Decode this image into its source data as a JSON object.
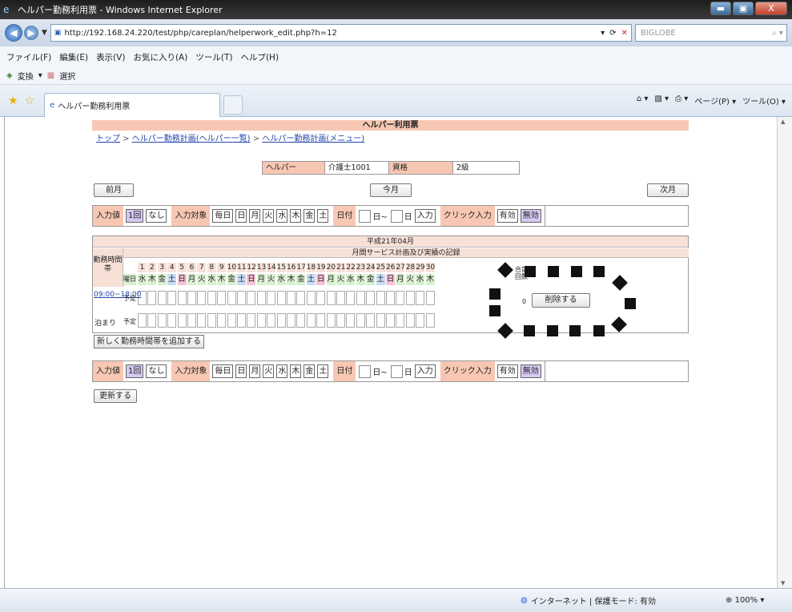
{
  "window": {
    "title": "ヘルパー勤務利用票 - Windows Internet Explorer",
    "btn_min": "▬",
    "btn_max": "▣",
    "btn_close": "X"
  },
  "browser": {
    "url": "http://192.168.24.220/test/php/careplan/helperwork_edit.php?h=12",
    "search_placeholder": "BIGLOBE",
    "menu": [
      "ファイル(F)",
      "編集(E)",
      "表示(V)",
      "お気に入り(A)",
      "ツール(T)",
      "ヘルプ(H)"
    ],
    "fav": [
      "変換",
      "選択"
    ],
    "tab_title": "ヘルパー勤務利用票",
    "tools": [
      "ページ(P) ▾",
      "ツール(O) ▾"
    ],
    "status_zone": "インターネット | 保護モード: 有効",
    "zoom": "100%"
  },
  "page": {
    "header": "ヘルパー利用票",
    "breadcrumbs": [
      "トップ",
      "ヘルパー勤務計画(ヘルパー一覧)",
      "ヘルパー勤務計画(メニュー)"
    ],
    "crumb_sep": ">",
    "info": {
      "helper_label": "ヘルパー",
      "helper_value": "介護士1001",
      "qual_label": "資格",
      "qual_value": "2級"
    },
    "prev_month": "前月",
    "this_month": "今月",
    "next_month": "次月",
    "controls": {
      "input_value_label": "入力値",
      "once": "1回",
      "none": "なし",
      "target_label": "入力対象",
      "everyday": "毎日",
      "days": [
        "日",
        "月",
        "火",
        "水",
        "木",
        "金",
        "土"
      ],
      "date_label": "日付",
      "day_from": "日~",
      "day_to": "日",
      "input_button": "入力",
      "click_input_label": "クリック入力",
      "enabled": "有効",
      "disabled": "無効"
    },
    "grid": {
      "month": "平成21年04月",
      "subtitle": "月間サービス計画及び実績の記録",
      "shift_label": "勤務時間帯",
      "weekday_label": "曜日",
      "total_label": "合計回数",
      "day_numbers": [
        "1",
        "2",
        "3",
        "4",
        "5",
        "6",
        "7",
        "8",
        "9",
        "10",
        "11",
        "12",
        "13",
        "14",
        "15",
        "16",
        "17",
        "18",
        "19",
        "20",
        "21",
        "22",
        "23",
        "24",
        "25",
        "26",
        "27",
        "28",
        "29",
        "30"
      ],
      "weekdays": [
        "水",
        "木",
        "金",
        "土",
        "日",
        "月",
        "火",
        "水",
        "木",
        "金",
        "土",
        "日",
        "月",
        "火",
        "水",
        "木",
        "金",
        "土",
        "日",
        "月",
        "火",
        "水",
        "木",
        "金",
        "土",
        "日",
        "月",
        "火",
        "水",
        "木"
      ],
      "rows": [
        {
          "time": "09:00~18:00",
          "plan": "予定",
          "total": "0",
          "delete": "削除する"
        },
        {
          "time": "泊まり",
          "plan": "予定"
        }
      ]
    },
    "add_shift": "新しく勤務時間帯を追加する",
    "update": "更新する"
  }
}
